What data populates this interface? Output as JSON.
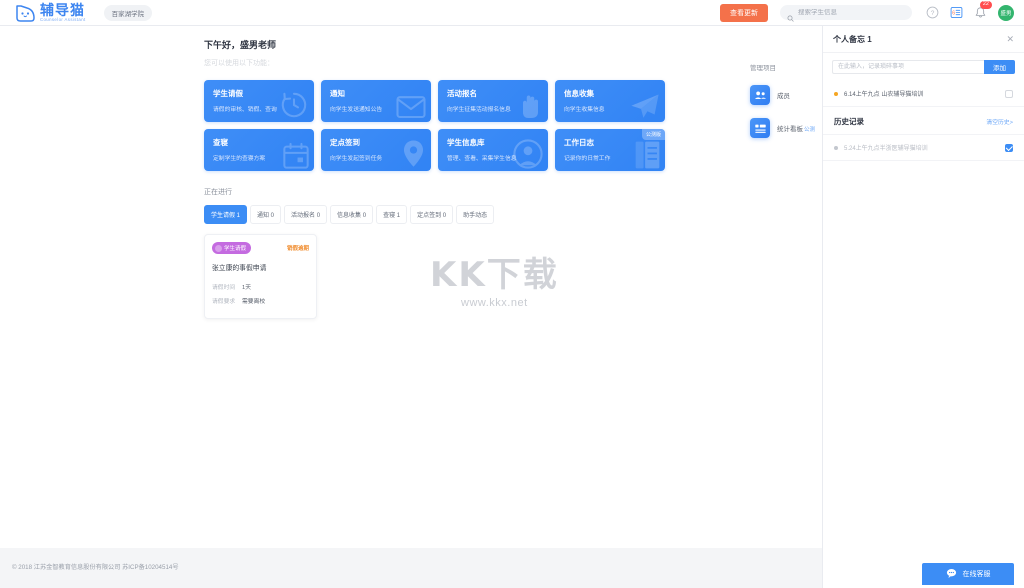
{
  "header": {
    "logo_cn": "辅导猫",
    "logo_en": "Counselor Assistant",
    "logo_icon": "cat-logo-icon",
    "school_badge": "百家湖学院",
    "update_button": "查看更新",
    "search_placeholder": "搜索学生信息",
    "search_value": "",
    "help_icon": "question-circle-icon",
    "form_icon": "form-list-icon",
    "bell_icon": "bell-icon",
    "notification_count": "22",
    "avatar_name": "盛男",
    "accent_color": "#3c8df5",
    "update_color": "#f4714a",
    "avatar_color": "#33b56e",
    "badge_color": "#ff4d4f"
  },
  "greeting": {
    "title": "下午好，盛男老师",
    "subtitle": "您可以使用以下功能："
  },
  "features": [
    {
      "title": "学生请假",
      "desc": "请假的审核、销假、查询",
      "icon": "clock-history-icon",
      "tag": ""
    },
    {
      "title": "通知",
      "desc": "向学生发送通知公告",
      "icon": "envelope-icon",
      "tag": ""
    },
    {
      "title": "活动报名",
      "desc": "向学生征集活动报名信息",
      "icon": "raised-hand-icon",
      "tag": ""
    },
    {
      "title": "信息收集",
      "desc": "向学生收集信息",
      "icon": "paper-plane-icon",
      "tag": ""
    },
    {
      "title": "查寝",
      "desc": "定制学生的查寝方案",
      "icon": "calendar-icon",
      "tag": ""
    },
    {
      "title": "定点签到",
      "desc": "向学生发起签到任务",
      "icon": "map-pin-icon",
      "tag": ""
    },
    {
      "title": "学生信息库",
      "desc": "管理、查看、采集学生信息",
      "icon": "user-circle-icon",
      "tag": ""
    },
    {
      "title": "工作日志",
      "desc": "记录你的日常工作",
      "icon": "document-icon",
      "tag": "公测版"
    }
  ],
  "ongoing": {
    "title": "正在进行",
    "tabs": [
      {
        "label": "学生请假 1",
        "active": true
      },
      {
        "label": "通知 0",
        "active": false
      },
      {
        "label": "活动报名 0",
        "active": false
      },
      {
        "label": "信息收集 0",
        "active": false
      },
      {
        "label": "查寝 1",
        "active": false
      },
      {
        "label": "定点签到 0",
        "active": false
      },
      {
        "label": "助手动态",
        "active": false
      }
    ],
    "task": {
      "type_label": "学生请假",
      "type_color": "#c46be0",
      "status_label": "销假逾期",
      "status_color": "#f08c2e",
      "title": "张立康的事假申请",
      "rows": [
        {
          "key": "请假时间",
          "value": "1天"
        },
        {
          "key": "请假要求",
          "value": "需要离校"
        }
      ]
    }
  },
  "manage": {
    "title": "管理项目",
    "items": [
      {
        "label": "成员",
        "beta": "",
        "icon": "members-group-icon"
      },
      {
        "label": "统计看板",
        "beta": "公测",
        "icon": "dashboard-chart-icon"
      }
    ]
  },
  "watermark": {
    "text": "KK下载",
    "url": "www.kkx.net"
  },
  "memo": {
    "title": "个人备忘 1",
    "close_icon": "close-icon",
    "input_placeholder": "在此输入，记录琐碎事项",
    "input_value": "",
    "add_button": "添加",
    "items": [
      {
        "text": "6.14上午九点 山农辅导猫培训",
        "checked": false,
        "dot": "orange"
      }
    ],
    "history_title": "历史记录",
    "history_clear": "清空历史>",
    "history_items": [
      {
        "text": "5.24上午九点半浙医辅导猫培训",
        "checked": true,
        "dot": "gray"
      }
    ]
  },
  "footer": {
    "text": "© 2018 江苏金智教育信息股份有限公司 苏ICP备10204514号"
  },
  "chat": {
    "label": "在线客服",
    "icon": "chat-bubble-icon"
  }
}
